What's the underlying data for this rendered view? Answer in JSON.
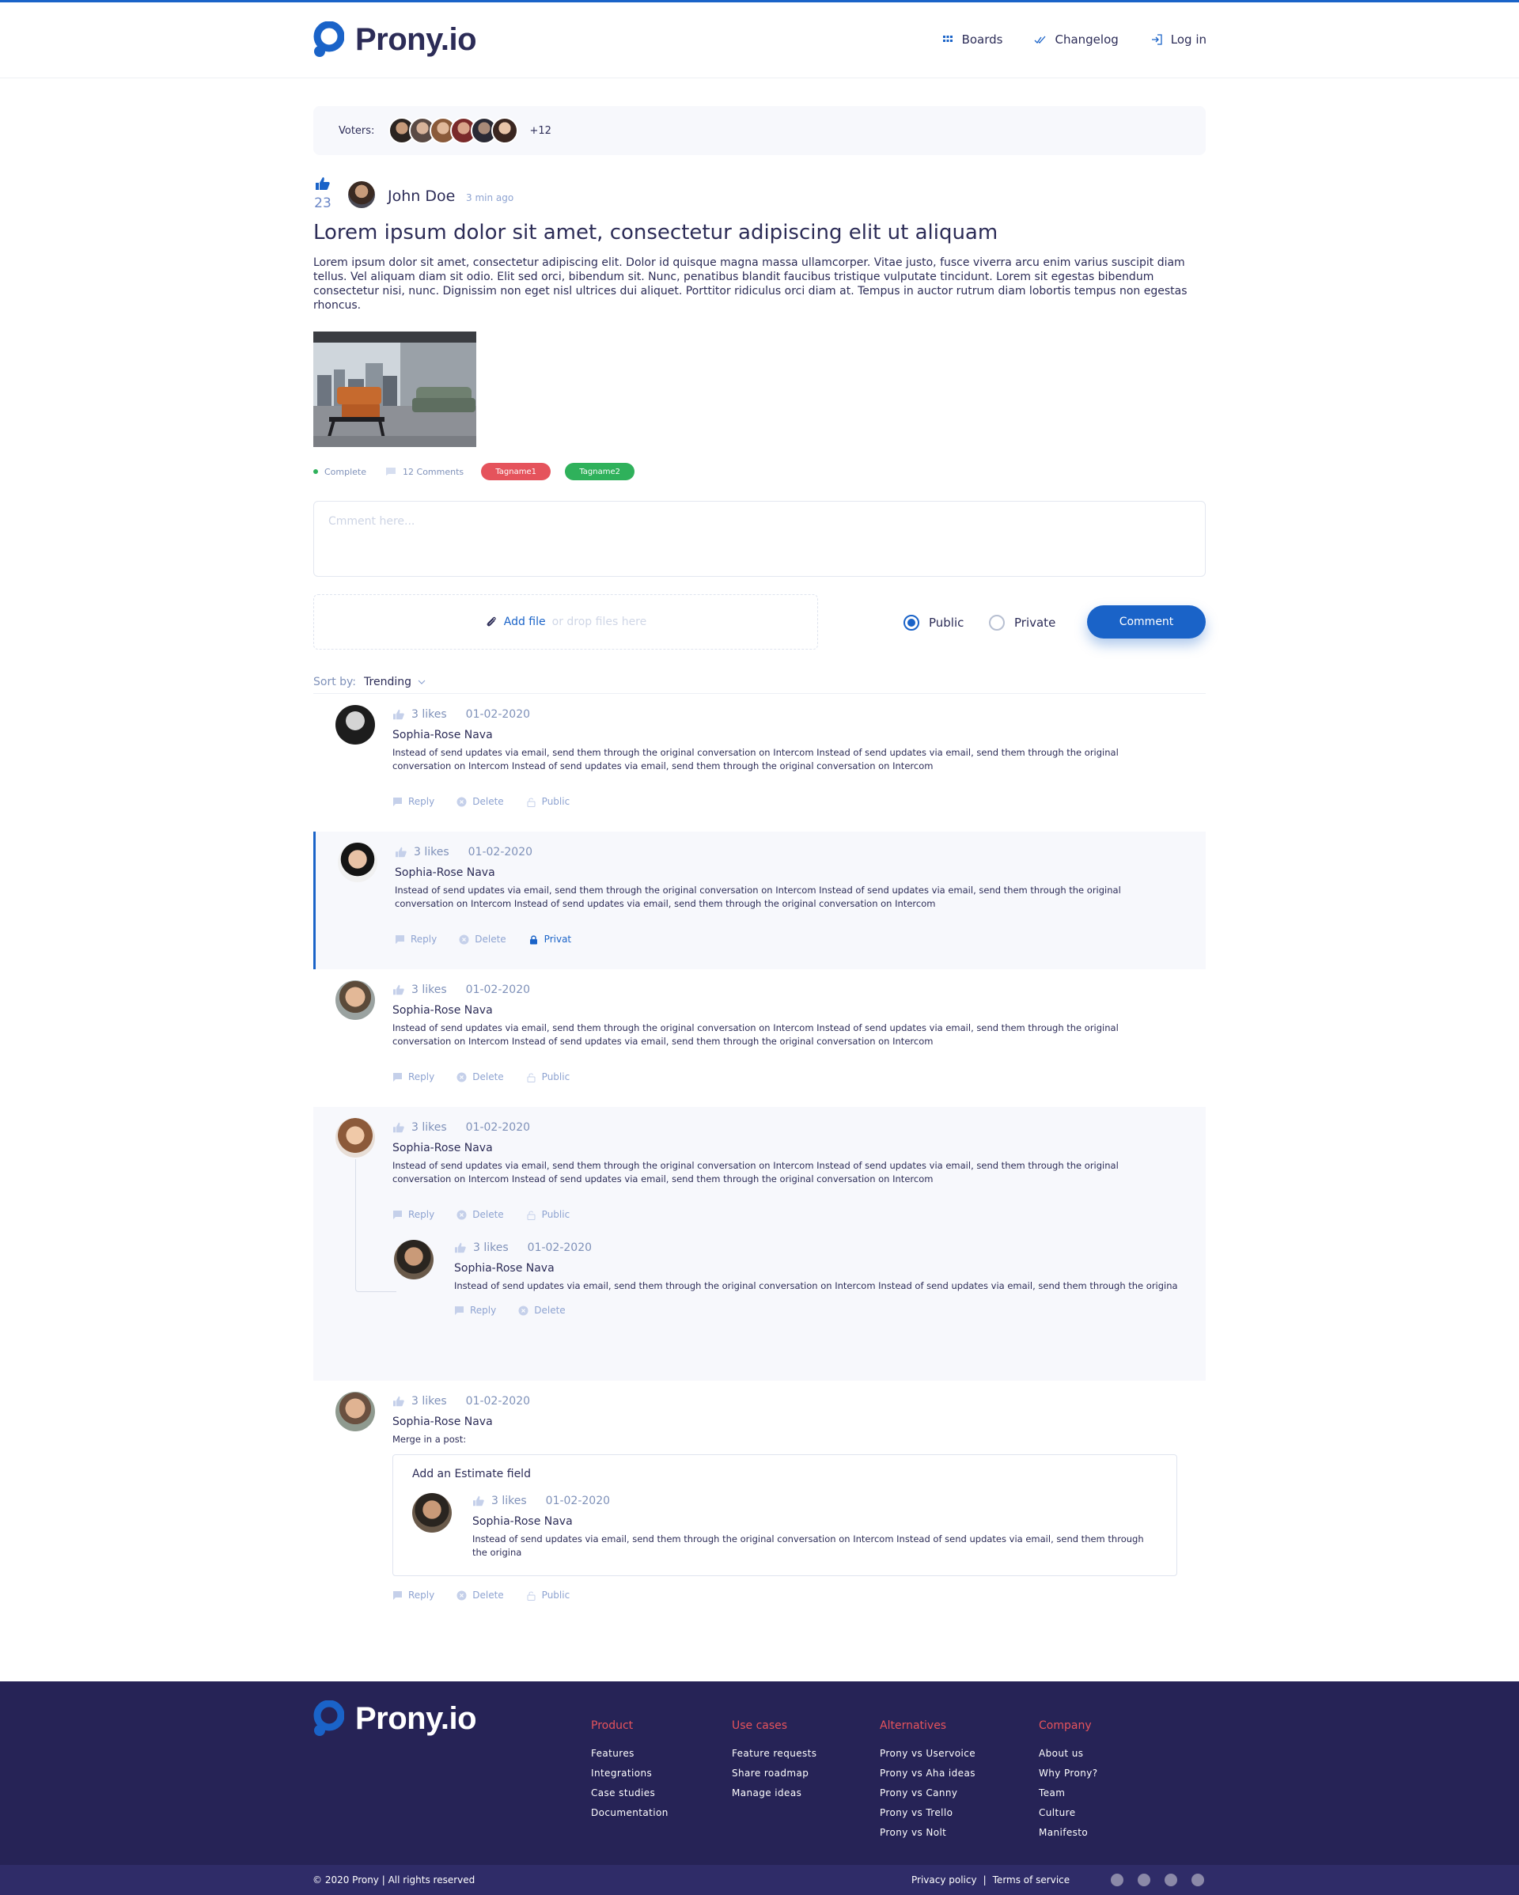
{
  "header": {
    "logo_text": "Prony.io",
    "nav": [
      {
        "label": "Boards",
        "icon": "grid-icon"
      },
      {
        "label": "Changelog",
        "icon": "check-double-icon"
      },
      {
        "label": "Log in",
        "icon": "login-icon"
      }
    ]
  },
  "voters": {
    "label": "Voters:",
    "more": "+12"
  },
  "post": {
    "votes": "23",
    "author": "John Doe",
    "time": "3 min ago",
    "title": "Lorem ipsum dolor sit amet, consectetur adipiscing elit ut aliquam",
    "body": "Lorem ipsum dolor sit amet, consectetur adipiscing elit. Dolor id quisque magna massa ullamcorper. Vitae justo, fusce viverra arcu enim varius suscipit diam tellus. Vel aliquam diam sit odio. Elit sed orci, bibendum sit. Nunc, penatibus blandit faucibus tristique vulputate tincidunt. Lorem sit egestas bibendum consectetur nisi, nunc. Dignissim non eget nisl ultrices dui aliquet. Porttitor ridiculus orci diam at. Tempus in auctor rutrum diam lobortis tempus non egestas rhoncus.",
    "status": "Complete",
    "comments_count": "12 Comments",
    "tags": [
      "Tagname1",
      "Tagname2"
    ]
  },
  "compose": {
    "placeholder": "Cmment here...",
    "add_file": "Add file",
    "drop_files": "or drop files here",
    "public_label": "Public",
    "private_label": "Private",
    "submit_label": "Comment"
  },
  "sort": {
    "label": "Sort by:",
    "value": "Trending"
  },
  "actions": {
    "reply": "Reply",
    "delete": "Delete",
    "public": "Public",
    "private": "Privat"
  },
  "comments": [
    {
      "likes": "3 likes",
      "date": "01-02-2020",
      "name": "Sophia-Rose Nava",
      "text": "Instead of send updates via email, send them through the original conversation on Intercom Instead of send updates via email, send them through the original conversation on Intercom Instead of send updates via email, send them through the original conversation on Intercom"
    },
    {
      "likes": "3 likes",
      "date": "01-02-2020",
      "name": "Sophia-Rose Nava",
      "text": "Instead of send updates via email, send them through the original conversation on Intercom Instead of send updates via email, send them through the original conversation on Intercom Instead of send updates via email, send them through the original conversation on Intercom"
    },
    {
      "likes": "3 likes",
      "date": "01-02-2020",
      "name": "Sophia-Rose Nava",
      "text": "Instead of send updates via email, send them through the original conversation on Intercom Instead of send updates via email, send them through the original conversation on Intercom Instead of send updates via email, send them through the original conversation on Intercom"
    },
    {
      "likes": "3 likes",
      "date": "01-02-2020",
      "name": "Sophia-Rose Nava",
      "text": "Instead of send updates via email, send them through the original conversation on Intercom Instead of send updates via email, send them through the original conversation on Intercom Instead of send updates via email, send them through the original conversation on Intercom",
      "reply": {
        "likes": "3 likes",
        "date": "01-02-2020",
        "name": "Sophia-Rose Nava",
        "text": "Instead of send updates via email, send them through the original conversation on Intercom Instead of send updates via email, send them through the origina"
      }
    },
    {
      "likes": "3 likes",
      "date": "01-02-2020",
      "name": "Sophia-Rose Nava",
      "merge_label": "Merge in a post:",
      "merge": {
        "title": "Add an Estimate field",
        "likes": "3 likes",
        "date": "01-02-2020",
        "name": "Sophia-Rose Nava",
        "text": "Instead of send updates via email, send them through the original conversation on Intercom Instead of send updates via email, send them through the origina"
      }
    }
  ],
  "footer": {
    "logo_text": "Prony.io",
    "columns": [
      {
        "title": "Product",
        "links": [
          "Features",
          "Integrations",
          "Case studies",
          "Documentation"
        ]
      },
      {
        "title": "Use cases",
        "links": [
          "Feature requests",
          "Share roadmap",
          "Manage ideas"
        ]
      },
      {
        "title": "Alternatives",
        "links": [
          "Prony vs Uservoice",
          "Prony vs Aha ideas",
          "Prony vs Canny",
          "Prony vs Trello",
          "Prony vs Nolt"
        ]
      },
      {
        "title": "Company",
        "links": [
          "About us",
          "Why Prony?",
          "Team",
          "Culture",
          "Manifesto"
        ]
      }
    ],
    "copyright": "© 2020 Prony  |  All rights reserved",
    "privacy": "Privacy policy",
    "separator": "|",
    "terms": "Terms of service",
    "social": [
      "facebook-icon",
      "instagram-icon",
      "twitter-icon",
      "youtube-icon"
    ]
  },
  "colors": {
    "brand": "#1a63c8",
    "navy": "#2c2c57",
    "footer_bg": "#262356",
    "tag_red": "#e5535c",
    "tag_green": "#2fb15b"
  }
}
